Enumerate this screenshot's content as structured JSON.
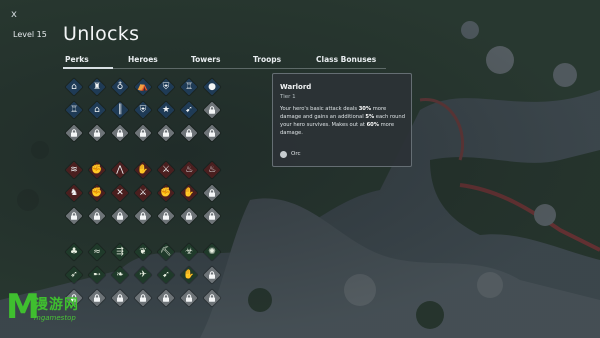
{
  "header": {
    "close_label": "x",
    "level_label": "Level 15",
    "title": "Unlocks"
  },
  "tabs": [
    {
      "label": "Perks",
      "active": true
    },
    {
      "label": "Heroes",
      "active": false
    },
    {
      "label": "Towers",
      "active": false
    },
    {
      "label": "Troops",
      "active": false
    },
    {
      "label": "Class Bonuses",
      "active": false
    }
  ],
  "perk_groups": [
    {
      "color": "blue",
      "row1": [
        "house",
        "tower",
        "potion",
        "tent",
        "shield",
        "castle",
        "cannonball"
      ],
      "row2": [
        "castle-walls",
        "barracks",
        "fence",
        "shield-man",
        "star",
        "archer"
      ],
      "row3_locked": 7
    },
    {
      "color": "red",
      "row1": [
        "claws",
        "brute",
        "spikes",
        "torch-fist",
        "sword",
        "flame",
        "flames"
      ],
      "row2": [
        "ogre",
        "fist-flame",
        "crossed-blades",
        "crossed-swords",
        "raised-fist",
        "bone-hand"
      ],
      "row3_locked": 7
    },
    {
      "color": "green",
      "row1": [
        "sprout",
        "wind",
        "wing-arrows",
        "laurel",
        "pickaxe",
        "poison",
        "sun-swirl"
      ],
      "row2": [
        "bow",
        "dart",
        "vines",
        "swallow",
        "arrow-bird",
        "hand"
      ],
      "row3_locked": 7
    }
  ],
  "tooltip": {
    "title": "Warlord",
    "tier": "Tier 1",
    "desc_pre": "Your hero's basic attack deals ",
    "desc_b1": "30%",
    "desc_mid": " more damage and gains an additional ",
    "desc_b2": "5%",
    "desc_mid2": " each round your hero survives. Makes out at ",
    "desc_b3": "60%",
    "desc_post": " more damage.",
    "race": "Orc",
    "race_icon": "orc-skull-icon"
  },
  "watermark": {
    "letter": "M",
    "chinese": "漫游网",
    "sub": "mgamestop"
  },
  "colors": {
    "blue": "#1f3b56",
    "red": "#4a1f1f",
    "green": "#1f3a2a",
    "locked": "#6e7478"
  }
}
